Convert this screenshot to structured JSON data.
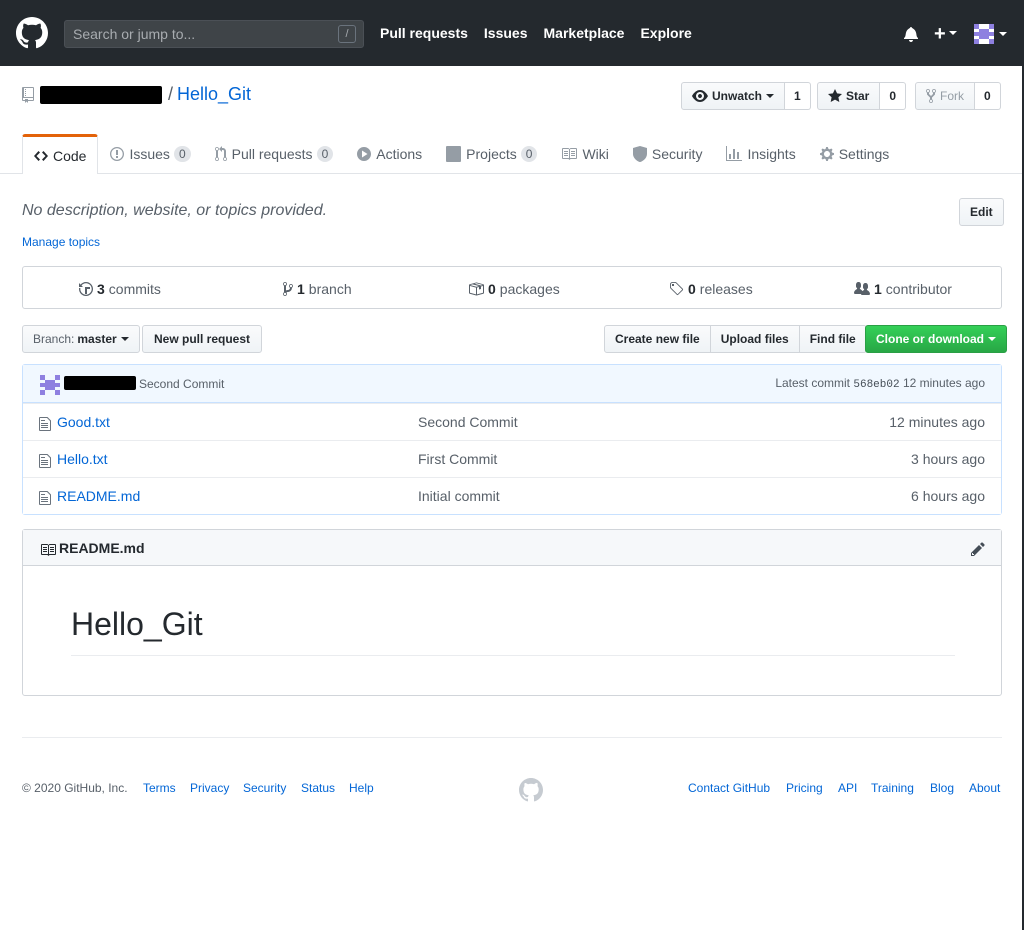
{
  "header": {
    "search_placeholder": "Search or jump to...",
    "search_shortcut": "/",
    "nav": [
      "Pull requests",
      "Issues",
      "Marketplace",
      "Explore"
    ],
    "plus": "+"
  },
  "repo": {
    "separator": "/",
    "name": "Hello_Git",
    "watch_label": "Unwatch",
    "watch_count": "1",
    "star_label": "Star",
    "star_count": "0",
    "fork_label": "Fork",
    "fork_count": "0"
  },
  "tabs": [
    {
      "label": "Code",
      "icon": "code-icon"
    },
    {
      "label": "Issues",
      "icon": "issue-icon",
      "count": "0"
    },
    {
      "label": "Pull requests",
      "icon": "pull-request-icon",
      "count": "0"
    },
    {
      "label": "Actions",
      "icon": "play-icon"
    },
    {
      "label": "Projects",
      "icon": "project-icon",
      "count": "0"
    },
    {
      "label": "Wiki",
      "icon": "book-icon"
    },
    {
      "label": "Security",
      "icon": "shield-icon"
    },
    {
      "label": "Insights",
      "icon": "graph-icon"
    },
    {
      "label": "Settings",
      "icon": "gear-icon"
    }
  ],
  "about": {
    "description": "No description, website, or topics provided.",
    "edit_label": "Edit",
    "manage_topics": "Manage topics"
  },
  "summary": {
    "commits_count": "3",
    "commits_label": "commits",
    "branch_count": "1",
    "branch_label": "branch",
    "packages_count": "0",
    "packages_label": "packages",
    "releases_count": "0",
    "releases_label": "releases",
    "contributor_count": "1",
    "contributor_label": "contributor"
  },
  "file_nav": {
    "branch_prefix": "Branch:",
    "branch_name": "master",
    "new_pr": "New pull request",
    "create_file": "Create new file",
    "upload_files": "Upload files",
    "find_file": "Find file",
    "clone": "Clone or download"
  },
  "commit_tease": {
    "message": "Second Commit",
    "latest_label": "Latest commit",
    "sha": "568eb02",
    "age": "12 minutes ago"
  },
  "files": [
    {
      "name": "Good.txt",
      "message": "Second Commit",
      "age": "12 minutes ago"
    },
    {
      "name": "Hello.txt",
      "message": "First Commit",
      "age": "3 hours ago"
    },
    {
      "name": "README.md",
      "message": "Initial commit",
      "age": "6 hours ago"
    }
  ],
  "readme": {
    "filename": "README.md",
    "heading": "Hello_Git"
  },
  "footer": {
    "copyright": "© 2020 GitHub, Inc.",
    "left_links": [
      "Terms",
      "Privacy",
      "Security",
      "Status",
      "Help"
    ],
    "right_links": [
      "Contact GitHub",
      "Pricing",
      "API",
      "Training",
      "Blog",
      "About"
    ]
  },
  "colors": {
    "header_bg": "#24292e",
    "link": "#0366d6",
    "tab_accent": "#e36209",
    "clone_green": "#28a745"
  }
}
